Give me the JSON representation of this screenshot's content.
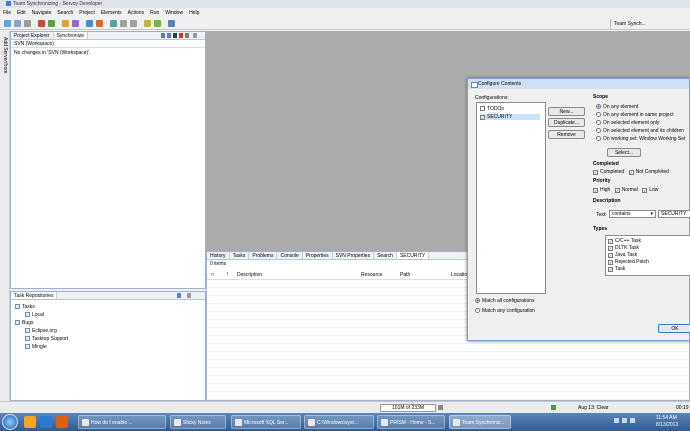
{
  "window": {
    "title": "Team Synchronizing - Servoy Developer"
  },
  "menu": [
    "File",
    "Edit",
    "Navigate",
    "Search",
    "Project",
    "Elements",
    "Actions",
    "Run",
    "Window",
    "Help"
  ],
  "perspective": {
    "label": "Team Synch..."
  },
  "left_strip": {
    "label": "Add Server/from"
  },
  "sync_panel": {
    "tabs": [
      "Project Explorer",
      "Synchronize"
    ],
    "header": "SVN (Workspace)",
    "message": "No changes in 'SVN (Workspace)'."
  },
  "repo_panel": {
    "title": "Task Repositories",
    "tree": [
      {
        "label": "Tasks",
        "level": 0
      },
      {
        "label": "Local",
        "level": 1
      },
      {
        "label": "Bugs",
        "level": 0
      },
      {
        "label": "Eclipse.org",
        "level": 1
      },
      {
        "label": "Tasktop Support",
        "level": 1
      },
      {
        "label": "Mingle",
        "level": 1
      }
    ]
  },
  "bottom_panel": {
    "tabs": [
      "History",
      "Tasks",
      "Problems",
      "Console",
      "Properties",
      "SVN Properties",
      "Search",
      "SECURITY"
    ],
    "count": "0 items",
    "columns": [
      "!",
      "Description",
      "Resource",
      "Path",
      "Location"
    ]
  },
  "dialog": {
    "title": "Configure Contents",
    "configurations_label": "Configurations:",
    "configurations": [
      {
        "label": "TODOs",
        "checked": false
      },
      {
        "label": "SECURITY",
        "checked": true
      }
    ],
    "buttons": {
      "new": "New...",
      "duplicate": "Duplicate...",
      "remove": "Remove",
      "select": "Select...",
      "ok": "OK"
    },
    "match_all": "Match all configurations",
    "match_any": "Match any configuration",
    "scope": {
      "title": "Scope",
      "options": [
        "On any element",
        "On any element in same project",
        "On selected element only",
        "On selected element and its children",
        "On working set:  Window Working Set"
      ],
      "selected": 0
    },
    "completed": {
      "title": "Completed",
      "options": [
        "Completed",
        "Not Completed"
      ]
    },
    "priority": {
      "title": "Priority",
      "options": [
        "High",
        "Normal",
        "Low"
      ]
    },
    "description": {
      "title": "Description",
      "text_label": "Text:",
      "operator": "contains",
      "value": "SECURITY"
    },
    "types": {
      "title": "Types",
      "items": [
        "C/C++ Task",
        "DLTK Task",
        "Java Task",
        "Rejected Patch",
        "Task"
      ]
    }
  },
  "status_bar": {
    "memory": "101M of 233M",
    "notice": "Aug 13: Clear",
    "right": "00:19"
  },
  "taskbar": {
    "items": [
      "How do I enable ...",
      "Sticky Notes",
      "Microsoft SQL Ser...",
      "C:\\Windows\\syst...",
      "PRISM - Home - S...",
      "Team Synchroniz..."
    ],
    "clock_time": "11:54 AM",
    "clock_date": "8/13/2013"
  },
  "colors": {
    "accent": "#2a6ad6",
    "taskbar": "#2e5b92",
    "panel_border": "#9fb2c9"
  }
}
